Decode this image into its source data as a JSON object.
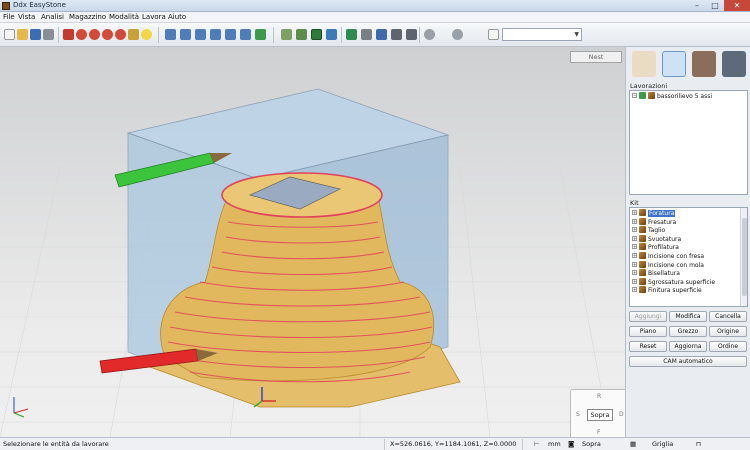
{
  "window": {
    "title": "Ddx EasyStone"
  },
  "menu": [
    "File",
    "Vista",
    "Analisi",
    "Magazzino",
    "Modalità",
    "Lavora",
    "Aiuto"
  ],
  "toolbar": {
    "icons": [
      "new-file-icon",
      "open-folder-icon",
      "save-icon",
      "print-icon",
      "undo-icon",
      "zoom-in-icon",
      "zoom-out-icon",
      "zoom-window-icon",
      "zoom-all-icon",
      "zoom-previous-icon",
      "pan-hand-icon",
      "pan-icon",
      "lightbulb-icon",
      "view-top-icon",
      "view-front-icon",
      "view-left-icon",
      "view-right-icon",
      "view-back-icon",
      "view-iso-icon",
      "view-3d-icon",
      "shade-icon",
      "wireframe-icon",
      "solid-icon",
      "measure-icon",
      "grid-icon",
      "layer-icon",
      "snap-icon",
      "select-icon",
      "cloud-icon",
      "cloud-icon-2",
      "page-icon"
    ],
    "combo_value": ""
  },
  "viewport": {
    "nest_label": "Nest",
    "viewcube": {
      "top": "R",
      "left": "S",
      "right": "D",
      "bottom": "F",
      "center": "Sopra"
    }
  },
  "panel": {
    "tabs": [
      "drawing-tab-icon",
      "machine-tab-icon",
      "stone-slab-tab-icon",
      "tool-tab-icon"
    ],
    "lavorazioni_label": "Lavorazioni",
    "lavorazioni_item": "bassorilievo 5 assi",
    "kit_label": "Kit",
    "kit_items": [
      "Foratura",
      "Fresatura",
      "Taglio",
      "Svuotatura",
      "Profilatura",
      "Incisione con fresa",
      "Incisione con mola",
      "Bisellatura",
      "Sgrossatura superficie",
      "Finitura superficie"
    ],
    "buttons": {
      "aggiungi": "Aggiungi",
      "modifica": "Modifica",
      "cancella": "Cancella",
      "piano": "Piano",
      "grezzo": "Grezzo",
      "origine": "Origine",
      "reset": "Reset",
      "aggiorna": "Aggiorna",
      "ordine": "Ordine",
      "cam": "CAM automatico"
    }
  },
  "status": {
    "message": "Selezionare le entità da lavorare",
    "coords": "X=526.0616, Y=1184.1061, Z=0.0000",
    "unit": "mm",
    "view": "Sopra",
    "grid": "Griglia"
  },
  "colors": {
    "titlebar": "#c9d8ea",
    "close": "#c7473b",
    "selection": "#3f72c9",
    "block": "#a9c7e0",
    "toolpath": "#e0425b",
    "stone": "#e4be6a"
  }
}
